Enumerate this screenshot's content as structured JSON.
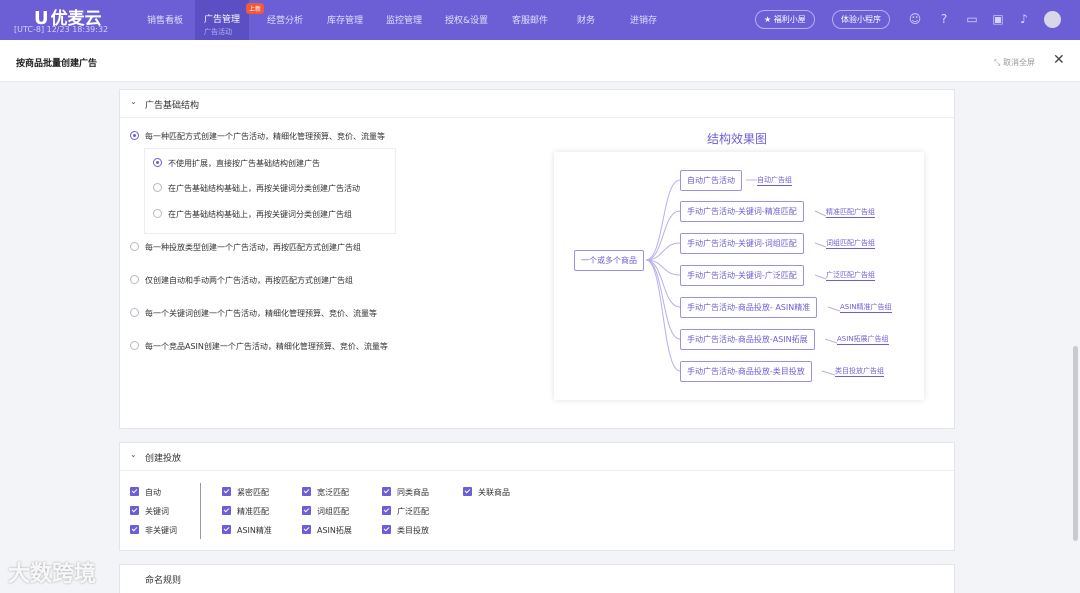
{
  "nav": {
    "logo": "优麦云",
    "clock": "[UTC-8] 12/23 18:39:32",
    "items": [
      "销售看板",
      "广告管理",
      "经营分析",
      "库存管理",
      "监控管理",
      "授权&设置",
      "客服邮件",
      "财务",
      "进销存"
    ],
    "active_sub": "广告活动",
    "new_badge": "上新",
    "welfare_btn": "福利小屋",
    "miniapp_btn": "体验小程序"
  },
  "modal": {
    "title": "按商品批量创建广告",
    "exit_fullscreen": "取消全屏"
  },
  "structure": {
    "header": "广告基础结构",
    "options": [
      "每一种匹配方式创建一个广告活动，精细化管理预算、竞价、流量等",
      "每一种投放类型创建一个广告活动，再按匹配方式创建广告组",
      "仅创建自动和手动两个广告活动，再按匹配方式创建广告组",
      "每一个关键词创建一个广告活动，精细化管理预算、竞价、流量等",
      "每一个竞品ASIN创建一个广告活动，精细化管理预算、竞价、流量等"
    ],
    "sub_options": [
      "不使用扩展，直接按广告基础结构创建广告",
      "在广告基础结构基础上，再按关键词分类创建广告活动",
      "在广告基础结构基础上，再按关键词分类创建广告组"
    ],
    "selected_option": 0,
    "selected_sub_option": 0
  },
  "diagram": {
    "title": "结构效果图",
    "root": "一个或多个商品",
    "branches": [
      {
        "campaign": "自动广告活动",
        "group": "自动广告组"
      },
      {
        "campaign": "手动广告活动-关键词-精准匹配",
        "group": "精准匹配广告组"
      },
      {
        "campaign": "手动广告活动-关键词-词组匹配",
        "group": "词组匹配广告组"
      },
      {
        "campaign": "手动广告活动-关键词-广泛匹配",
        "group": "广泛匹配广告组"
      },
      {
        "campaign": "手动广告活动-商品投放- ASIN精准",
        "group": "ASIN精准广告组"
      },
      {
        "campaign": "手动广告活动-商品投放-ASIN拓展",
        "group": "ASIN拓展广告组"
      },
      {
        "campaign": "手动广告活动-商品投放-类目投放",
        "group": "类目投放广告组"
      }
    ]
  },
  "targeting": {
    "header": "创建投放",
    "left": [
      "自动",
      "关键词",
      "非关键词"
    ],
    "grid": [
      [
        "紧密匹配",
        "宽泛匹配",
        "同类商品",
        "关联商品"
      ],
      [
        "精准匹配",
        "词组匹配",
        "广泛匹配"
      ],
      [
        "ASIN精准",
        "ASIN拓展",
        "类目投放"
      ]
    ]
  },
  "naming": {
    "header": "命名规则"
  },
  "watermark": "大数跨境",
  "colors": {
    "accent": "#6c5fd6",
    "nav_bg": "#6c5fd6"
  }
}
